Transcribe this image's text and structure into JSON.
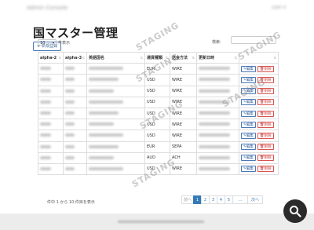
{
  "header": {
    "brand": "Admin Console",
    "user": "user ▾"
  },
  "page": {
    "title": "国マスター管理",
    "new_button_label": "新規登録"
  },
  "controls": {
    "page_length_value": "10",
    "page_length_suffix": "件表示",
    "search_label": "検索:",
    "search_placeholder": ""
  },
  "table": {
    "headers": [
      "alpha-2",
      "alpha-3",
      "英語国名",
      "通貨種類",
      "送金方法",
      "更新日時",
      ""
    ],
    "rows": [
      {
        "currency": "EUR",
        "method": "WIRE"
      },
      {
        "currency": "USD",
        "method": "WIRE"
      },
      {
        "currency": "USD",
        "method": "WIRE"
      },
      {
        "currency": "USD",
        "method": "WIRE"
      },
      {
        "currency": "USD",
        "method": "WIRE"
      },
      {
        "currency": "USD",
        "method": "WIRE"
      },
      {
        "currency": "USD",
        "method": "WIRE"
      },
      {
        "currency": "EUR",
        "method": "SEPA"
      },
      {
        "currency": "AUD",
        "method": "ACH"
      },
      {
        "currency": "USD",
        "method": "WIRE"
      }
    ],
    "edit_label": "編集",
    "delete_label": "削除"
  },
  "footer_info": "件中 1 から 10 件目を表示",
  "pagination": {
    "prev": "前へ",
    "pages": [
      "1",
      "2",
      "3",
      "4",
      "5",
      "…"
    ],
    "next": "次へ",
    "active_page": "1"
  },
  "watermark": "STAGING",
  "colors": {
    "primary": "#337ab7",
    "danger": "#d9534f",
    "fab": "#2b2b2b"
  },
  "icons": {
    "fab": "search-icon",
    "new": "plus-icon",
    "edit": "pencil-icon",
    "delete": "trash-icon"
  }
}
